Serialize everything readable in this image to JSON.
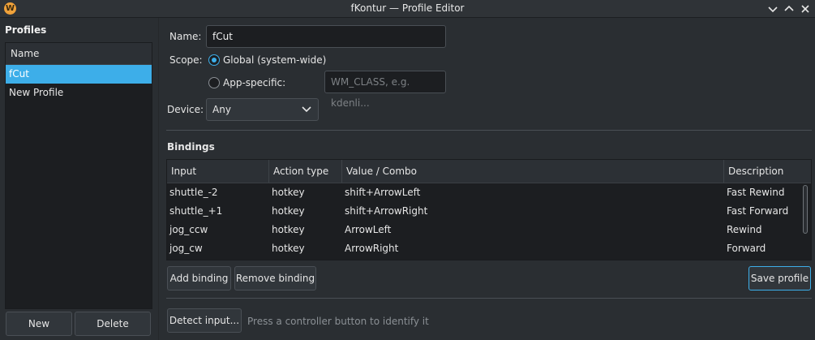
{
  "window": {
    "title": "fKontur — Profile Editor",
    "app_icon_letter": "W"
  },
  "profiles": {
    "heading": "Profiles",
    "column_header": "Name",
    "items": [
      "fCut",
      "New Profile"
    ],
    "selected": "fCut",
    "new_label": "New",
    "delete_label": "Delete"
  },
  "editor": {
    "name_label": "Name:",
    "name_value": "fCut",
    "scope_label": "Scope:",
    "scope_global_label": "Global (system-wide)",
    "scope_app_label": "App-specific:",
    "scope_selected": "global",
    "wm_class_placeholder": "WM_CLASS, e.g. kdenli...",
    "device_label": "Device:",
    "device_value": "Any"
  },
  "bindings": {
    "heading": "Bindings",
    "columns": [
      "Input",
      "Action type",
      "Value / Combo",
      "Description"
    ],
    "rows": [
      [
        "shuttle_-2",
        "hotkey",
        "shift+ArrowLeft",
        "Fast Rewind"
      ],
      [
        "shuttle_+1",
        "hotkey",
        "shift+ArrowRight",
        "Fast Forward"
      ],
      [
        "jog_ccw",
        "hotkey",
        "ArrowLeft",
        "Rewind"
      ],
      [
        "jog_cw",
        "hotkey",
        "ArrowRight",
        "Forward"
      ]
    ],
    "add_label": "Add binding",
    "remove_label": "Remove binding",
    "save_label": "Save profile"
  },
  "detect": {
    "button_label": "Detect input...",
    "hint": "Press a controller button to identify it"
  },
  "colors": {
    "accent": "#3daee9",
    "background": "#2a2e32",
    "field": "#1c1e21"
  }
}
